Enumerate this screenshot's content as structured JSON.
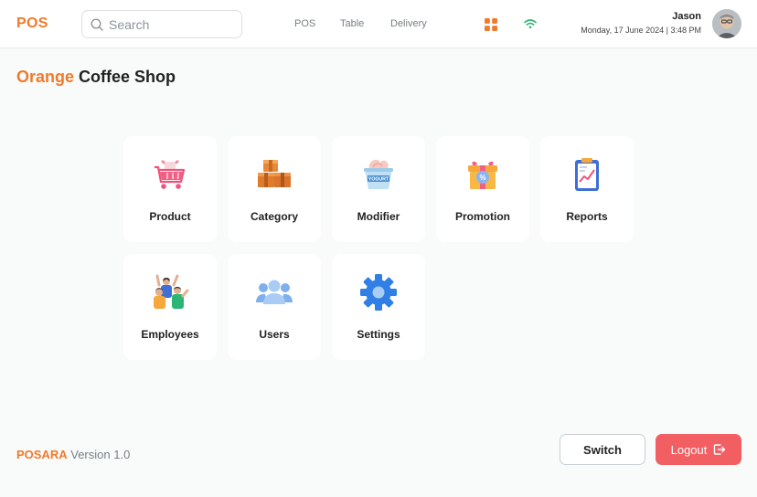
{
  "header": {
    "brand": "POS",
    "search": {
      "placeholder": "Search",
      "value": ""
    },
    "nav": [
      {
        "label": "POS"
      },
      {
        "label": "Table"
      },
      {
        "label": "Delivery"
      }
    ],
    "user": {
      "name": "Jason",
      "datetime": "Monday, 17 June 2024 | 3:48 PM"
    }
  },
  "shop": {
    "accent": "Orange",
    "name": "Coffee Shop"
  },
  "tiles": [
    {
      "label": "Product",
      "icon": "shopping-cart-icon"
    },
    {
      "label": "Category",
      "icon": "boxes-icon"
    },
    {
      "label": "Modifier",
      "icon": "yogurt-icon"
    },
    {
      "label": "Promotion",
      "icon": "gift-discount-icon"
    },
    {
      "label": "Reports",
      "icon": "clipboard-chart-icon"
    },
    {
      "label": "Employees",
      "icon": "employees-icon"
    },
    {
      "label": "Users",
      "icon": "users-icon"
    },
    {
      "label": "Settings",
      "icon": "gear-icon"
    }
  ],
  "footer": {
    "brand": "POSARA",
    "version": "Version 1.0",
    "switch_label": "Switch",
    "logout_label": "Logout"
  },
  "colors": {
    "accent": "#f07a2c",
    "logout": "#f25f62",
    "wifi": "#2bb673"
  }
}
